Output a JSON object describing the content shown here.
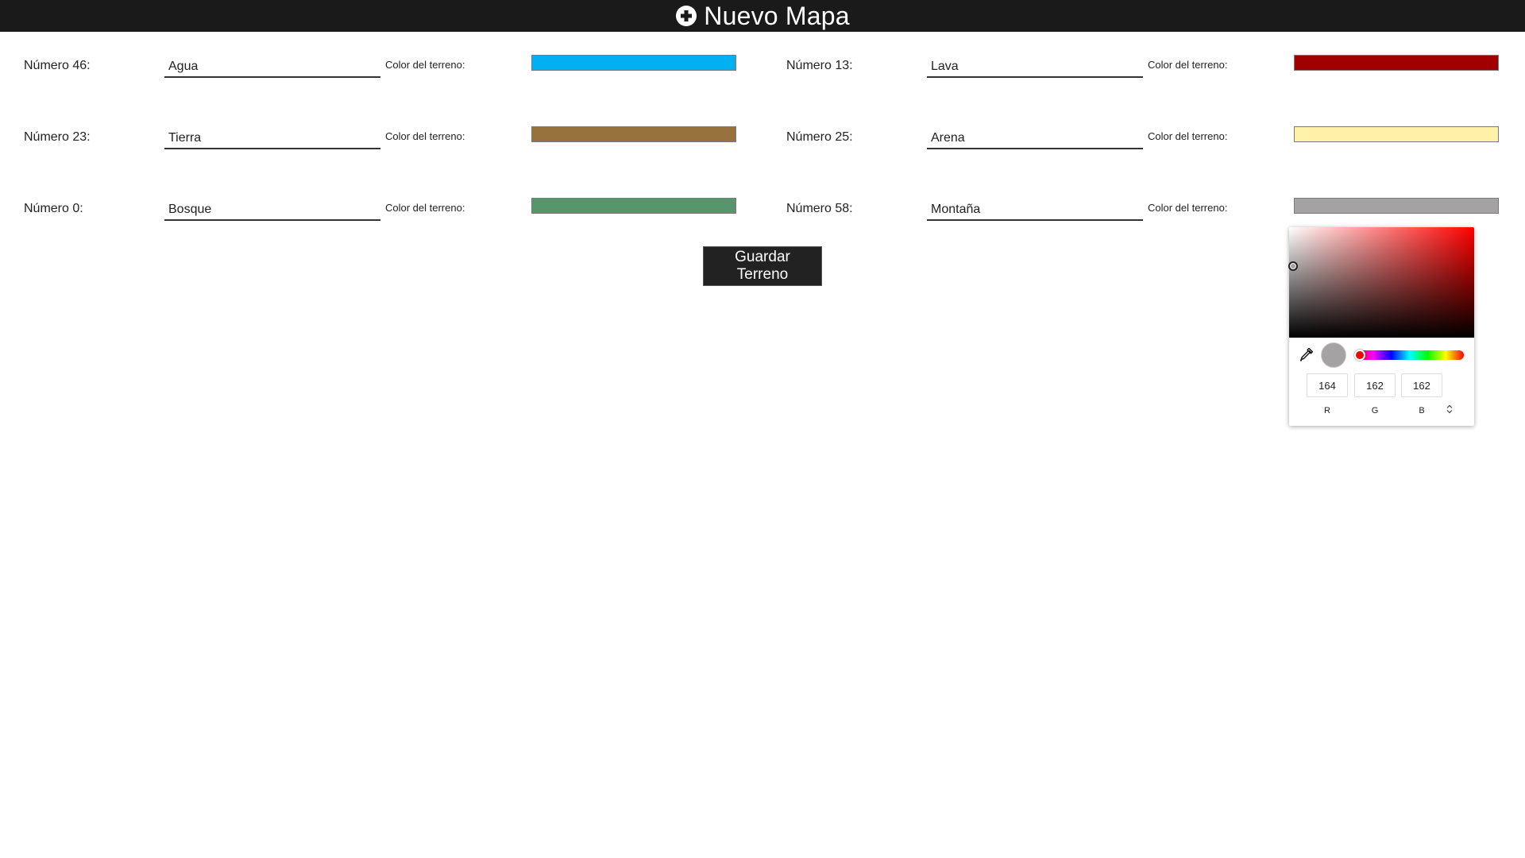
{
  "header": {
    "title": "Nuevo Mapa",
    "icon": "plus-circle-icon"
  },
  "terrains": [
    {
      "number_label": "Número 46:",
      "name": "Agua",
      "color_label": "Color del terreno:",
      "color": "#00b0f0"
    },
    {
      "number_label": "Número 13:",
      "name": "Lava",
      "color_label": "Color del terreno:",
      "color": "#a10000"
    },
    {
      "number_label": "Número 23:",
      "name": "Tierra",
      "color_label": "Color del terreno:",
      "color": "#98723c"
    },
    {
      "number_label": "Número 25:",
      "name": "Arena",
      "color_label": "Color del terreno:",
      "color": "#fff2a8"
    },
    {
      "number_label": "Número 0:",
      "name": "Bosque",
      "color_label": "Color del terreno:",
      "color": "#56966a"
    },
    {
      "number_label": "Número 58:",
      "name": "Montaña",
      "color_label": "Color del terreno:",
      "color": "#a4a2a2"
    }
  ],
  "save_button": {
    "label": "Guardar Terreno"
  },
  "color_picker": {
    "preview_color": "#a4a2a2",
    "hue_color": "#ff0000",
    "r": "164",
    "g": "162",
    "b": "162",
    "r_label": "R",
    "g_label": "G",
    "b_label": "B",
    "mode_toggle_icon": "up-down-arrows-icon",
    "eyedropper_icon": "eyedropper-icon"
  }
}
